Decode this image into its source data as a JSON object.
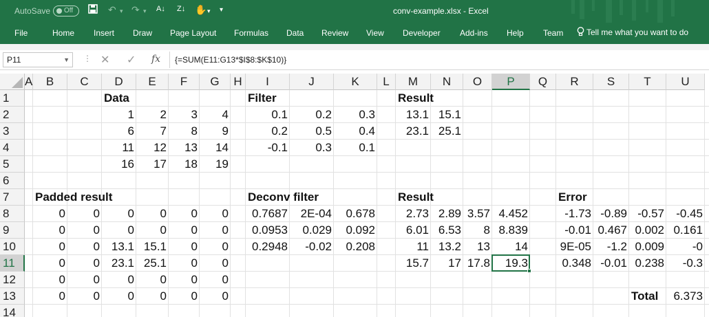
{
  "titlebar": {
    "autosave_label": "AutoSave",
    "autosave_state": "Off",
    "doc_title": "conv-example.xlsx  -  Excel",
    "accent_color": "#217346"
  },
  "quick_access": {
    "save_icon": "save-icon",
    "undo_icon": "undo-icon",
    "redo_icon": "redo-icon",
    "sort_asc_icon": "sort-ascending-icon",
    "sort_desc_icon": "sort-descending-icon",
    "custom_icon": "touch-mode-icon",
    "customize_icon": "customize-quick-access-icon"
  },
  "ribbon": {
    "tabs": [
      "File",
      "Home",
      "Insert",
      "Draw",
      "Page Layout",
      "Formulas",
      "Data",
      "Review",
      "View",
      "Developer",
      "Add-ins",
      "Help",
      "Team"
    ],
    "tell_me": "Tell me what you want to do"
  },
  "formula_bar": {
    "name_box": "P11",
    "fx_label": "fx",
    "formula": "{=SUM(E11:G13*$I$8:$K$10)}"
  },
  "grid": {
    "columns": [
      "A",
      "B",
      "C",
      "D",
      "E",
      "F",
      "G",
      "H",
      "I",
      "J",
      "K",
      "L",
      "M",
      "N",
      "O",
      "P",
      "Q",
      "R",
      "S",
      "T",
      "U"
    ],
    "rows": [
      "1",
      "2",
      "3",
      "4",
      "5",
      "6",
      "7",
      "8",
      "9",
      "10",
      "11",
      "12",
      "13",
      "14"
    ],
    "selected_column": "P",
    "selected_row": "11",
    "cells": {
      "D1": "Data",
      "I1": "Filter",
      "M1": "Result",
      "D2": "1",
      "E2": "2",
      "F2": "3",
      "G2": "4",
      "I2": "0.1",
      "J2": "0.2",
      "K2": "0.3",
      "M2": "13.1",
      "N2": "15.1",
      "D3": "6",
      "E3": "7",
      "F3": "8",
      "G3": "9",
      "I3": "0.2",
      "J3": "0.5",
      "K3": "0.4",
      "M3": "23.1",
      "N3": "25.1",
      "D4": "11",
      "E4": "12",
      "F4": "13",
      "G4": "14",
      "I4": "-0.1",
      "J4": "0.3",
      "K4": "0.1",
      "D5": "16",
      "E5": "17",
      "F5": "18",
      "G5": "19",
      "B7": "Padded result",
      "I7": "Deconv filter",
      "M7": "Result",
      "R7": "Error",
      "B8": "0",
      "C8": "0",
      "D8": "0",
      "E8": "0",
      "F8": "0",
      "G8": "0",
      "I8": "0.7687",
      "J8": "2E-04",
      "K8": "0.678",
      "M8": "2.73",
      "N8": "2.89",
      "O8": "3.57",
      "P8": "4.452",
      "R8": "-1.73",
      "S8": "-0.89",
      "T8": "-0.57",
      "U8": "-0.45",
      "B9": "0",
      "C9": "0",
      "D9": "0",
      "E9": "0",
      "F9": "0",
      "G9": "0",
      "I9": "0.0953",
      "J9": "0.029",
      "K9": "0.092",
      "M9": "6.01",
      "N9": "6.53",
      "O9": "8",
      "P9": "8.839",
      "R9": "-0.01",
      "S9": "0.467",
      "T9": "0.002",
      "U9": "0.161",
      "B10": "0",
      "C10": "0",
      "D10": "13.1",
      "E10": "15.1",
      "F10": "0",
      "G10": "0",
      "I10": "0.2948",
      "J10": "-0.02",
      "K10": "0.208",
      "M10": "11",
      "N10": "13.2",
      "O10": "13",
      "P10": "14",
      "R10": "9E-05",
      "S10": "-1.2",
      "T10": "0.009",
      "U10": "-0",
      "B11": "0",
      "C11": "0",
      "D11": "23.1",
      "E11": "25.1",
      "F11": "0",
      "G11": "0",
      "M11": "15.7",
      "N11": "17",
      "O11": "17.8",
      "P11": "19.3",
      "R11": "0.348",
      "S11": "-0.01",
      "T11": "0.238",
      "U11": "-0.3",
      "B12": "0",
      "C12": "0",
      "D12": "0",
      "E12": "0",
      "F12": "0",
      "G12": "0",
      "B13": "0",
      "C13": "0",
      "D13": "0",
      "E13": "0",
      "F13": "0",
      "G13": "0",
      "T13": "Total",
      "U13": "6.373"
    }
  }
}
